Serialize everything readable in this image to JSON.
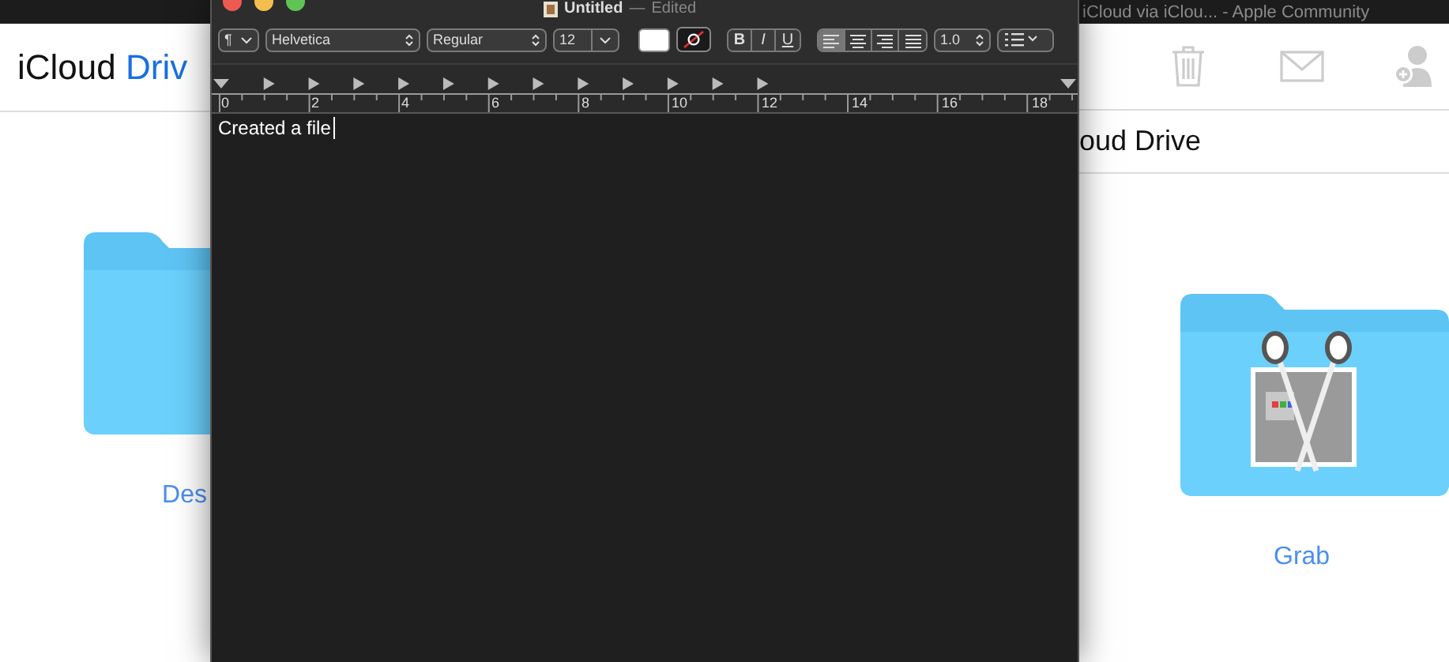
{
  "browser_tab_title": "iCloud via iClou... - Apple Community",
  "left_page": {
    "header_plain": "iCloud ",
    "header_accent": "Driv",
    "folder_label": "Des"
  },
  "right_page": {
    "header": "oud Drive",
    "folder_label": "Grab"
  },
  "editor": {
    "title": "Untitled",
    "separator": "—",
    "status": "Edited",
    "toolbar": {
      "paragraph": "¶",
      "font": "Helvetica",
      "typeface": "Regular",
      "size": "12",
      "bold": "B",
      "italic": "I",
      "underline": "U",
      "alignment": [
        {
          "kind": "left",
          "selected": true
        },
        {
          "kind": "center",
          "selected": false
        },
        {
          "kind": "right",
          "selected": false
        },
        {
          "kind": "justify",
          "selected": false
        }
      ],
      "spacing": "1.0"
    },
    "ruler_labels": [
      "0",
      "2",
      "4",
      "6",
      "8",
      "10",
      "12",
      "14",
      "16",
      "18"
    ],
    "body": "Created a file"
  }
}
